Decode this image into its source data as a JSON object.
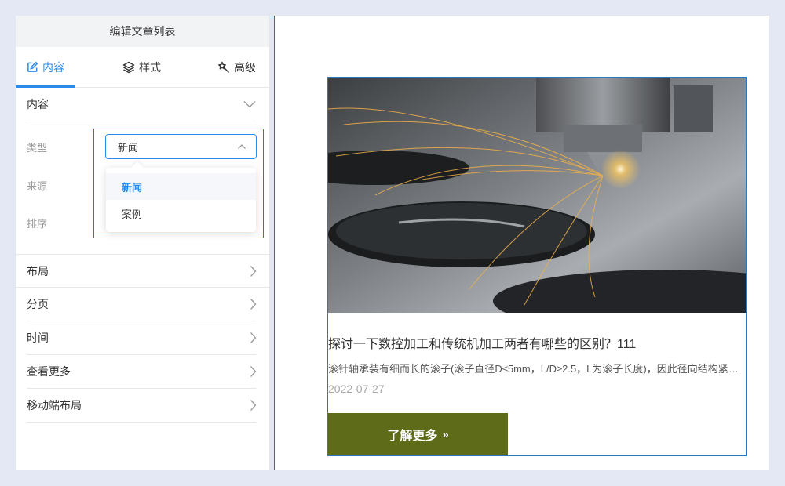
{
  "panel": {
    "title": "编辑文章列表",
    "tabs": [
      {
        "label": "内容",
        "icon": "edit-icon",
        "active": true
      },
      {
        "label": "样式",
        "icon": "layers-icon",
        "active": false
      },
      {
        "label": "高级",
        "icon": "magic-icon",
        "active": false
      }
    ],
    "content_section": {
      "label": "内容",
      "expanded": true
    },
    "fields": {
      "type_label": "类型",
      "source_label": "来源",
      "sort_label": "排序"
    },
    "type_select": {
      "value": "新闻",
      "options": [
        {
          "label": "新闻",
          "selected": true
        },
        {
          "label": "案例",
          "selected": false
        }
      ]
    },
    "sections": [
      {
        "label": "布局"
      },
      {
        "label": "分页"
      },
      {
        "label": "时间"
      },
      {
        "label": "查看更多"
      },
      {
        "label": "移动端布局"
      }
    ]
  },
  "preview": {
    "card": {
      "title": "探讨一下数控加工和传统机加工两者有哪些的区别？111",
      "description": "滚针轴承装有细而长的滚子(滚子直径D≤5mm，L/D≥2.5，L为滚子长度)，因此径向结构紧凑，其内径尺寸和载荷能力与其它类型轴承相同时，外径最小",
      "date": "2022-07-27",
      "button_label": "了解更多",
      "button_color": "#5e6b19"
    }
  },
  "colors": {
    "accent": "#2a8bea",
    "highlight": "#d9363e"
  }
}
